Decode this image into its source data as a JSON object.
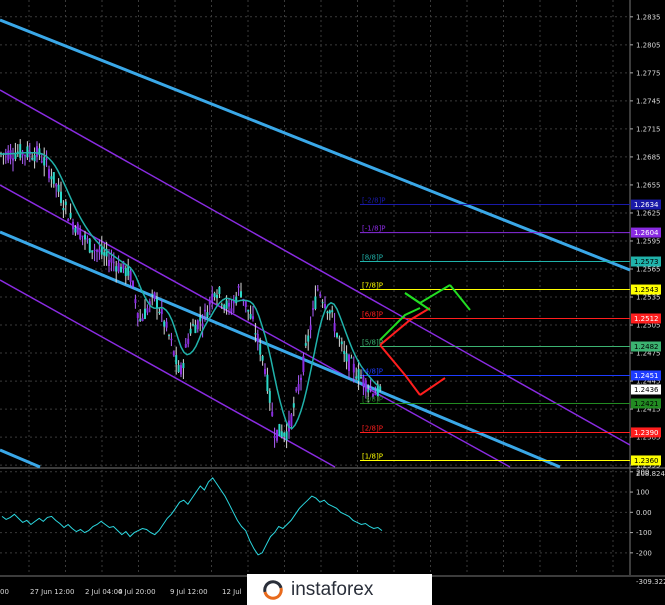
{
  "chart_data": {
    "type": "candlestick",
    "price_axis": {
      "ticks": [
        "1.2835",
        "1.2805",
        "1.2775",
        "1.2745",
        "1.2715",
        "1.2685",
        "1.2655",
        "1.2625",
        "1.2595",
        "1.2565",
        "1.2535",
        "1.2505",
        "1.2475",
        "1.2445",
        "1.2415",
        "1.2385",
        "1.2355"
      ],
      "range": [
        1.2353,
        1.2853
      ]
    },
    "price_tags": [
      {
        "value": "1.2634",
        "price": 1.2634,
        "color": "#1a1aa8",
        "text_color": "#ffffff"
      },
      {
        "value": "1.2604",
        "price": 1.2604,
        "color": "#8a2be2",
        "text_color": "#ffffff"
      },
      {
        "value": "1.2573",
        "price": 1.2573,
        "color": "#20b2aa",
        "text_color": "#000000"
      },
      {
        "value": "1.2543",
        "price": 1.2543,
        "color": "#ffff00",
        "text_color": "#000000"
      },
      {
        "value": "1.2512",
        "price": 1.2512,
        "color": "#ff1e1e",
        "text_color": "#ffffff"
      },
      {
        "value": "1.2482",
        "price": 1.2482,
        "color": "#3cb371",
        "text_color": "#000000"
      },
      {
        "value": "1.2451",
        "price": 1.2451,
        "color": "#1e3cff",
        "text_color": "#ffffff"
      },
      {
        "value": "1.2436",
        "price": 1.2436,
        "color": "#ffffff",
        "text_color": "#000000"
      },
      {
        "value": "1.2421",
        "price": 1.2421,
        "color": "#228b22",
        "text_color": "#000000"
      },
      {
        "value": "1.2390",
        "price": 1.239,
        "color": "#ff1e1e",
        "text_color": "#ffffff"
      },
      {
        "value": "1.2360",
        "price": 1.236,
        "color": "#ffff00",
        "text_color": "#000000"
      }
    ],
    "murrey_levels": [
      {
        "label": "[-1/8]P",
        "price": 1.2604,
        "color": "#8a2be2"
      },
      {
        "label": "[8/8]P",
        "price": 1.2573,
        "color": "#20b2aa"
      },
      {
        "label": "[7/8]P",
        "price": 1.2543,
        "color": "#ffff00"
      },
      {
        "label": "[6/8]P",
        "price": 1.2512,
        "color": "#ff1e1e"
      },
      {
        "label": "[5/8]P",
        "price": 1.2482,
        "color": "#3cb371"
      },
      {
        "label": "[4/8]P",
        "price": 1.2451,
        "color": "#1e3cff"
      },
      {
        "label": "[3/8]P",
        "price": 1.2421,
        "color": "#228b22"
      },
      {
        "label": "[2/8]P",
        "price": 1.239,
        "color": "#ff1e1e"
      },
      {
        "label": "[1/8]P",
        "price": 1.236,
        "color": "#ffff00"
      },
      {
        "label": "[-2/8]P",
        "price": 1.2634,
        "color": "#1a1aa8"
      }
    ],
    "time_labels": [
      "00",
      "27 Jun 12:00",
      "2 Jul 04:00",
      "4 Jul 20:00",
      "9 Jul 12:00",
      "12 Jul"
    ],
    "oscillator": {
      "ticks": [
        "200",
        "100",
        "0.00",
        "-100",
        "-200"
      ],
      "range": [
        -309.322,
        208.8249
      ],
      "max_label": "208.8249",
      "min_label": "-309.3220",
      "values": [
        -20,
        -35,
        -25,
        -10,
        -30,
        -50,
        -40,
        -60,
        -45,
        -30,
        -45,
        -25,
        -20,
        -40,
        -55,
        -75,
        -60,
        -80,
        -95,
        -85,
        -100,
        -90,
        -70,
        -60,
        -45,
        -60,
        -75,
        -70,
        -90,
        -110,
        -95,
        -120,
        -100,
        -90,
        -80,
        -85,
        -100,
        -110,
        -90,
        -60,
        -30,
        -10,
        20,
        50,
        60,
        40,
        70,
        100,
        130,
        110,
        150,
        170,
        140,
        110,
        80,
        40,
        0,
        -40,
        -70,
        -90,
        -140,
        -180,
        -210,
        -200,
        -160,
        -120,
        -100,
        -70,
        -80,
        -60,
        -40,
        -10,
        20,
        40,
        60,
        80,
        70,
        50,
        60,
        40,
        30,
        20,
        0,
        -10,
        -20,
        -40,
        -50,
        -60,
        -55,
        -70,
        -80,
        -75,
        -90
      ]
    },
    "watermark": "instaforex"
  }
}
